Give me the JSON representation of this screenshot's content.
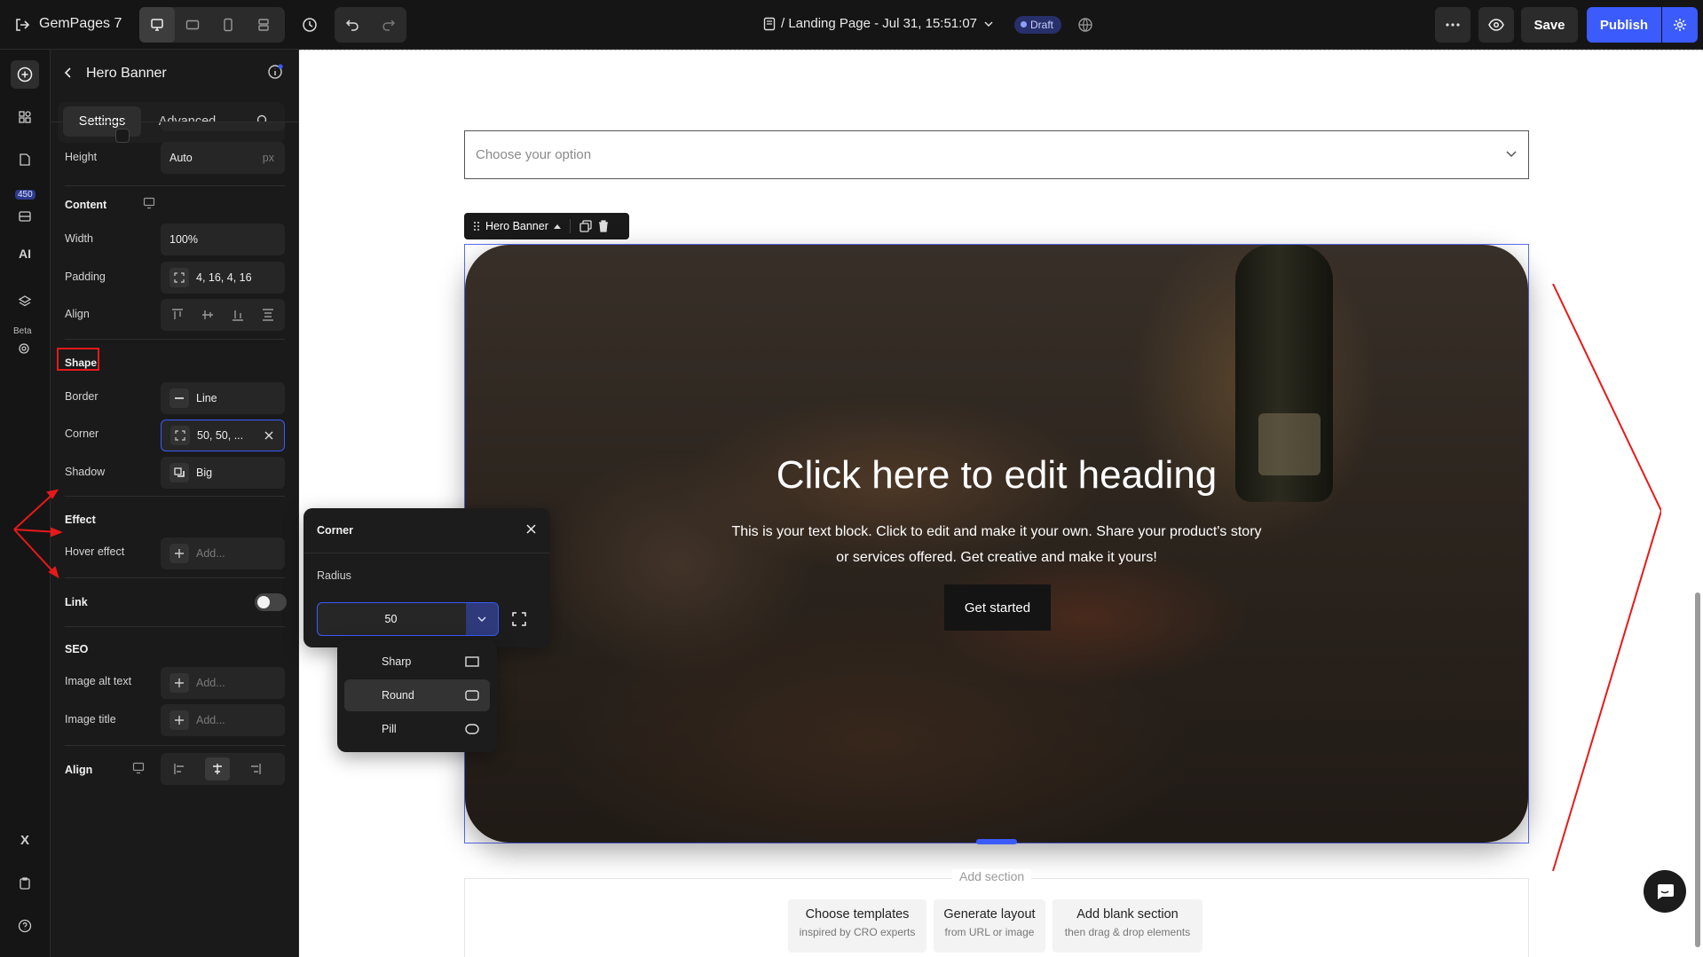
{
  "app": {
    "name": "GemPages 7",
    "back_icon": "exit-icon"
  },
  "toolbar": {
    "page_title": "/ Landing Page - Jul 31, 15:51:07",
    "status_badge": "Draft",
    "save_label": "Save",
    "publish_label": "Publish"
  },
  "rail": {
    "badge_count": "450",
    "ai_label": "AI",
    "beta_label": "Beta"
  },
  "panel": {
    "title": "Hero Banner",
    "tabs": {
      "settings": "Settings",
      "advanced": "Advanced"
    },
    "height": {
      "label": "Height",
      "value": "Auto",
      "unit": "px"
    },
    "content": {
      "heading": "Content",
      "width": {
        "label": "Width",
        "value": "100%"
      },
      "padding": {
        "label": "Padding",
        "value": "4, 16, 4, 16"
      },
      "align": {
        "label": "Align"
      }
    },
    "shape": {
      "heading": "Shape",
      "border": {
        "label": "Border",
        "value": "Line"
      },
      "corner": {
        "label": "Corner",
        "value": "50, 50, ..."
      },
      "shadow": {
        "label": "Shadow",
        "value": "Big"
      }
    },
    "effect": {
      "heading": "Effect",
      "hover": {
        "label": "Hover effect",
        "placeholder": "Add..."
      }
    },
    "link": {
      "heading": "Link",
      "enabled": false
    },
    "seo": {
      "heading": "SEO",
      "alt": {
        "label": "Image alt text",
        "placeholder": "Add..."
      },
      "title": {
        "label": "Image title",
        "placeholder": "Add..."
      }
    },
    "align_bottom": {
      "heading": "Align"
    }
  },
  "corner_popover": {
    "title": "Corner",
    "radius_label": "Radius",
    "radius_value": "50",
    "options": [
      {
        "label": "Sharp",
        "icon": "sharp-corner-icon"
      },
      {
        "label": "Round",
        "icon": "round-corner-icon",
        "selected": true
      },
      {
        "label": "Pill",
        "icon": "pill-corner-icon"
      }
    ]
  },
  "canvas": {
    "select_placeholder": "Choose your option",
    "element_tag": "Hero Banner",
    "hero": {
      "heading": "Click here to edit heading",
      "text_line1": "This is your text block. Click to edit and make it your own. Share your product's story",
      "text_line2": "or services offered. Get creative and make it yours!",
      "button": "Get started"
    },
    "add_section": {
      "label": "Add section",
      "options": [
        {
          "title": "Choose templates",
          "sub": "inspired by CRO experts"
        },
        {
          "title": "Generate layout",
          "sub": "from URL or image"
        },
        {
          "title": "Add blank section",
          "sub": "then drag & drop elements"
        }
      ]
    }
  },
  "colors": {
    "accent": "#3b5bfd",
    "annotation": "#e8191a",
    "panel_bg": "#1a1a1a"
  }
}
